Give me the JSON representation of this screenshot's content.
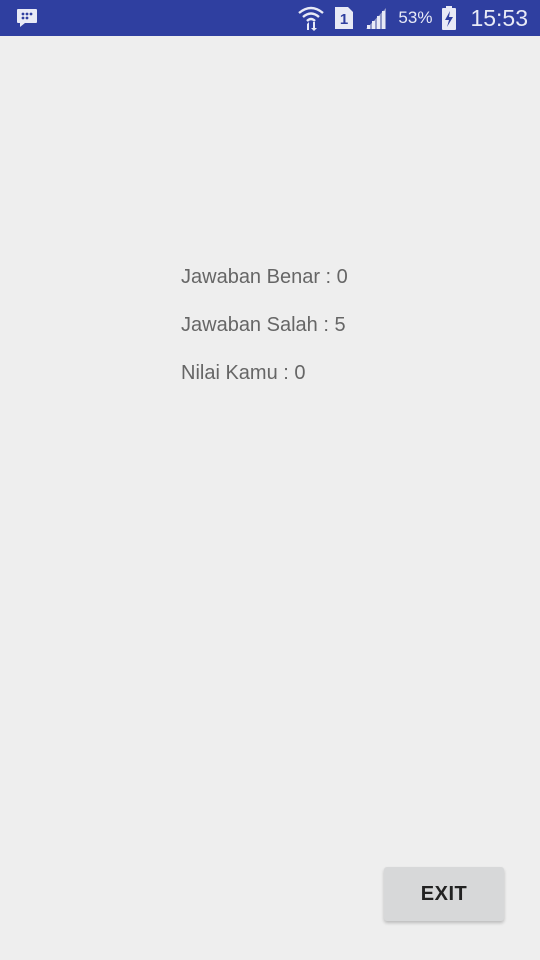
{
  "status_bar": {
    "notification_icon": "chat-bubble-icon",
    "wifi_icon": "wifi-icon",
    "sim_icon": "sim-1-icon",
    "sim_label": "1",
    "signal_icon": "signal-icon",
    "battery_percent": "53%",
    "battery_icon": "battery-charging-icon",
    "time": "15:53",
    "background_color": "#2f3fa0"
  },
  "result": {
    "correct_label": "Jawaban Benar : 0",
    "wrong_label": "Jawaban Salah : 5",
    "score_label": "Nilai Kamu : 0",
    "text_color": "#666666"
  },
  "actions": {
    "exit_label": "EXIT"
  }
}
